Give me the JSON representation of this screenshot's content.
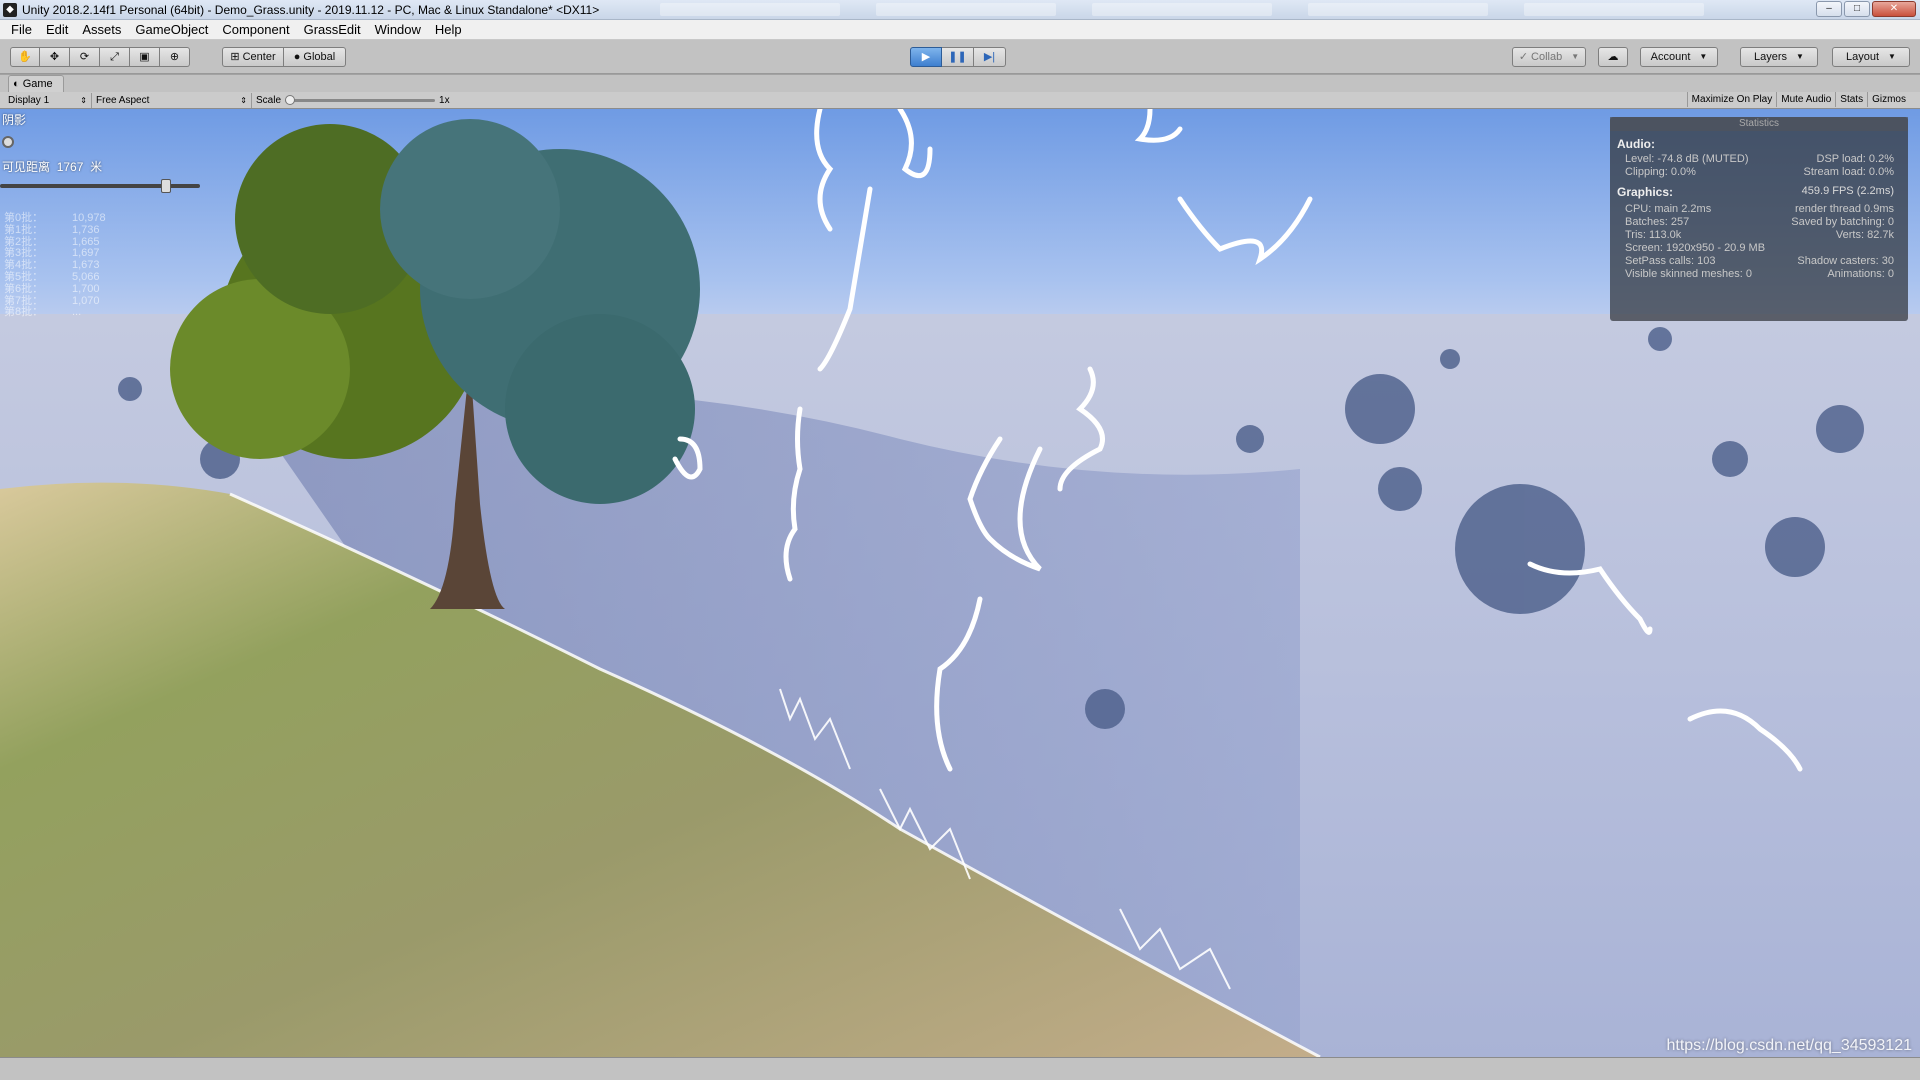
{
  "window": {
    "title": "Unity 2018.2.14f1 Personal (64bit) - Demo_Grass.unity - 2019.11.12 - PC, Mac & Linux Standalone* <DX11>",
    "controls": {
      "minimize": "–",
      "maximize": "□",
      "close": "✕"
    }
  },
  "menu": [
    "File",
    "Edit",
    "Assets",
    "GameObject",
    "Component",
    "GrassEdit",
    "Window",
    "Help"
  ],
  "toolbar": {
    "tools": [
      "hand-icon",
      "move-icon",
      "rotate-icon",
      "scale-icon",
      "rect-icon",
      "transform-icon"
    ],
    "pivot": "Center",
    "space": "Global",
    "play": "▶",
    "pause": "❚❚",
    "step": "▶|",
    "collab": "Collab",
    "account": "Account",
    "layers": "Layers",
    "layout": "Layout"
  },
  "game_tab": {
    "label": "Game",
    "display": "Display 1",
    "aspect": "Free Aspect",
    "scale_label": "Scale",
    "scale_value": "1x",
    "right_buttons": [
      "Maximize On Play",
      "Mute Audio",
      "Stats",
      "Gizmos"
    ]
  },
  "overlay": {
    "shadow_label": "阴影",
    "view_distance_label": "可见距离",
    "view_distance_value": "1767",
    "view_distance_unit": "米",
    "view_distance_fraction": 0.83,
    "counts": [
      {
        "label": "第0批：",
        "value": "10,978"
      },
      {
        "label": "第1批：",
        "value": "1,736"
      },
      {
        "label": "第2批：",
        "value": "1,665"
      },
      {
        "label": "第3批：",
        "value": "1,697"
      },
      {
        "label": "第4批：",
        "value": "1,673"
      },
      {
        "label": "第5批：",
        "value": "5,066"
      },
      {
        "label": "第6批：",
        "value": "1,700"
      },
      {
        "label": "第7批：",
        "value": "1,070"
      },
      {
        "label": "第8批：",
        "value": "..."
      }
    ]
  },
  "statistics": {
    "header": "Statistics",
    "audio_title": "Audio:",
    "audio": [
      {
        "left": "Level: -74.8 dB (MUTED)",
        "right": "DSP load: 0.2%"
      },
      {
        "left": "Clipping: 0.0%",
        "right": "Stream load: 0.0%"
      }
    ],
    "graphics_title": "Graphics:",
    "fps": "459.9 FPS (2.2ms)",
    "graphics": [
      {
        "left": "CPU: main 2.2ms",
        "right": "render thread 0.9ms"
      },
      {
        "left": "Batches: 257",
        "right": "Saved by batching: 0"
      },
      {
        "left": "Tris: 113.0k",
        "right": "Verts: 82.7k"
      },
      {
        "left": "Screen: 1920x950 - 20.9 MB",
        "right": ""
      },
      {
        "left": "SetPass calls: 103",
        "right": "Shadow casters: 30"
      },
      {
        "left": "Visible skinned meshes: 0",
        "right": "Animations: 0"
      }
    ]
  },
  "watermark": "https://blog.csdn.net/qq_34593121",
  "colors": {
    "play_active": "#3e7fcf",
    "toolbar": "#c2c2c2",
    "sky": "#6f9be4"
  }
}
